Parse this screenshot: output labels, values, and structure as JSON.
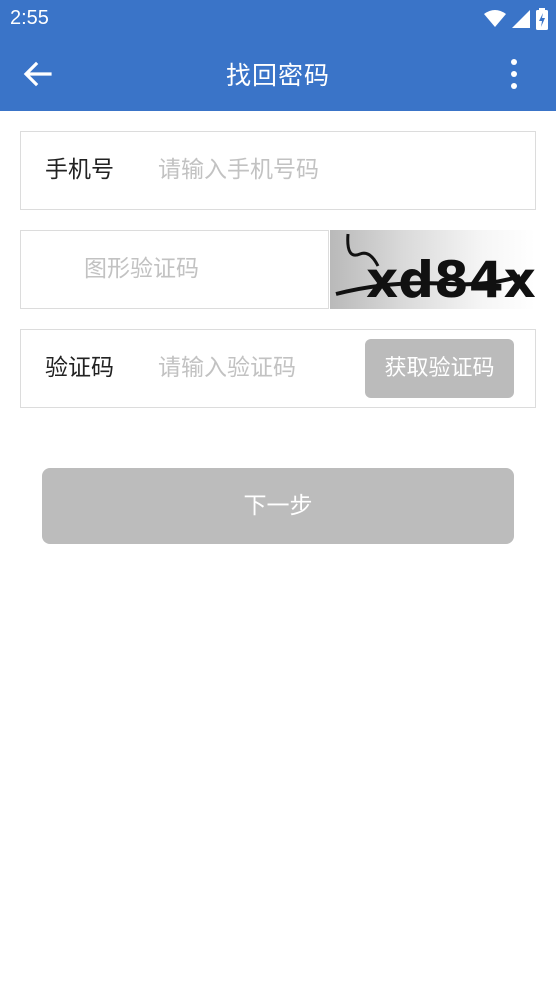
{
  "status_bar": {
    "time": "2:55",
    "icons": [
      "wifi-icon",
      "cellular-signal-icon",
      "battery-charging-icon"
    ]
  },
  "app_bar": {
    "title": "找回密码",
    "back_icon": "arrow-left-icon",
    "menu_icon": "more-vert-icon",
    "color": "#3a74c8"
  },
  "form": {
    "phone": {
      "label": "手机号",
      "placeholder": "请输入手机号码"
    },
    "captcha": {
      "placeholder": "图形验证码",
      "image_text": "xd84x"
    },
    "sms_code": {
      "label": "验证码",
      "placeholder": "请输入验证码",
      "get_code_label": "获取验证码"
    }
  },
  "next_button": {
    "label": "下一步"
  }
}
